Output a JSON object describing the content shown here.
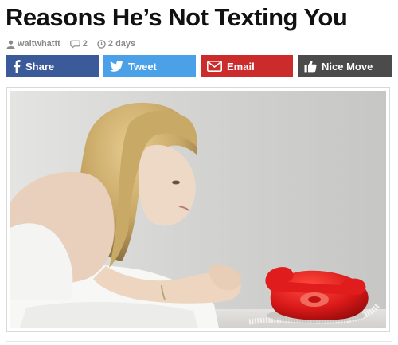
{
  "article": {
    "title": "Reasons He’s Not Texting You",
    "author": "waitwhattt",
    "comments": "2",
    "age": "2 days"
  },
  "share": {
    "facebook": {
      "label": "Share",
      "icon": "facebook-icon",
      "color": "#3b5a9a"
    },
    "twitter": {
      "label": "Tweet",
      "icon": "twitter-bird-icon",
      "color": "#4aa1e8"
    },
    "email": {
      "label": "Email",
      "icon": "envelope-icon",
      "color": "#cc2b2b"
    },
    "like": {
      "label": "Nice Move",
      "icon": "thumbs-up-icon",
      "color": "#4b4b4b"
    }
  },
  "colors": {
    "text": "#111111",
    "meta": "#8a8a8a",
    "phone_red": "#d81818"
  }
}
